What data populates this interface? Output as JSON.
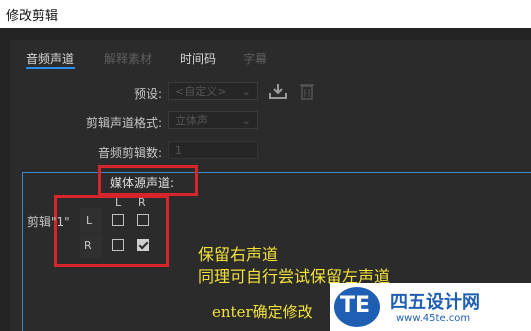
{
  "window": {
    "title": "修改剪辑"
  },
  "tabs": [
    {
      "label": "音频声道",
      "active": true
    },
    {
      "label": "解释素材",
      "active": false
    },
    {
      "label": "时间码",
      "active": false
    },
    {
      "label": "字幕",
      "active": false
    }
  ],
  "form": {
    "preset_label": "预设:",
    "preset_value": "<自定义>",
    "format_label": "剪辑声道格式:",
    "format_value": "立体声",
    "count_label": "音频剪辑数:",
    "count_value": "1"
  },
  "media_source_label": "媒体源声道:",
  "matrix": {
    "col_l": "L",
    "col_r": "R",
    "clip_label": "剪辑\"1\"",
    "row_l": "L",
    "row_r": "R",
    "row_l_values": {
      "L": false,
      "R": false
    },
    "row_r_values": {
      "L": false,
      "R": true
    }
  },
  "annotations": {
    "line1": "保留右声道",
    "line2": "同理可自行尝试保留左声道",
    "line3": "enter确定修改"
  },
  "watermark": {
    "logo": "TE",
    "name": "四五设计网",
    "url": "www.45te.com"
  },
  "colors": {
    "highlight_red": "#d7262b",
    "annotation_yellow": "#f3e23a",
    "tab_blue": "#2d8ceb",
    "watermark_blue": "#1f5fb3"
  }
}
